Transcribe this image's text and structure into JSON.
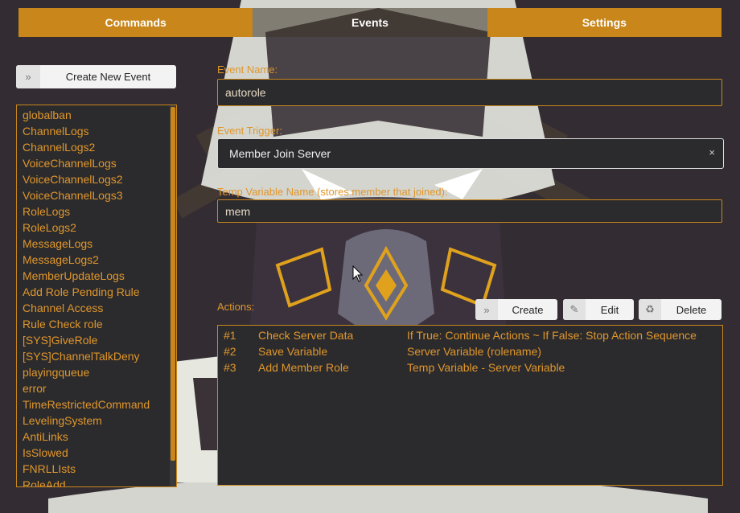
{
  "tabs": [
    {
      "label": "Commands"
    },
    {
      "label": "Events",
      "active": true
    },
    {
      "label": "Settings"
    }
  ],
  "create_event_label": "Create New Event",
  "events": [
    "globalban",
    "ChannelLogs",
    "ChannelLogs2",
    "VoiceChannelLogs",
    "VoiceChannelLogs2",
    "VoiceChannelLogs3",
    "RoleLogs",
    "RoleLogs2",
    "MessageLogs",
    "MessageLogs2",
    "MemberUpdateLogs",
    "Add Role Pending Rule",
    "Channel Access",
    "Rule Check role",
    "[SYS]GiveRole",
    "[SYS]ChannelTalkDeny",
    "playingqueue",
    "error",
    "TimeRestrictedCommand",
    "LevelingSystem",
    "AntiLinks",
    "IsSlowed",
    "FNRLLIsts",
    "RoleAdd"
  ],
  "form": {
    "event_name_label": "Event Name:",
    "event_name_value": "autorole",
    "event_trigger_label": "Event Trigger:",
    "event_trigger_value": "Member Join Server",
    "temp_var_label": "Temp Variable Name (stores member that joined):",
    "temp_var_value": "mem"
  },
  "actions_label": "Actions:",
  "action_buttons": {
    "create": "Create",
    "edit": "Edit",
    "delete": "Delete"
  },
  "actions": [
    {
      "num": "#1",
      "name": "Check Server Data",
      "desc": "If True: Continue Actions ~ If False: Stop Action Sequence"
    },
    {
      "num": "#2",
      "name": "Save Variable",
      "desc": "Server Variable (rolename)"
    },
    {
      "num": "#3",
      "name": "Add Member Role",
      "desc": "Temp Variable - Server Variable"
    }
  ],
  "icons": {
    "chevron": "double-chevron-right-icon",
    "edit": "pencil-icon",
    "delete": "recycle-icon",
    "clear": "close-icon"
  },
  "colors": {
    "accent": "#c8861b",
    "text_accent": "#e0962a",
    "panel": "#2b2b2e"
  }
}
